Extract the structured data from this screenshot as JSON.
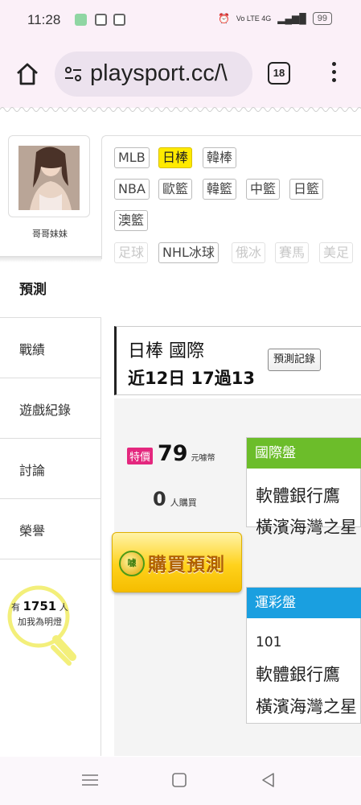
{
  "status_bar": {
    "time": "11:28",
    "battery": "99",
    "network_text": "Vo LTE 4G"
  },
  "browser": {
    "url": "playsport.cc/\\",
    "tab_count": "18"
  },
  "profile": {
    "name": "哥哥妹妹"
  },
  "sidebar": {
    "predict_tab": "預測",
    "items": [
      {
        "label": "戰績"
      },
      {
        "label": "遊戲紀錄"
      },
      {
        "label": "討論"
      },
      {
        "label": "榮譽"
      }
    ],
    "fan": {
      "prefix": "有",
      "count": "1751",
      "suffix": "人",
      "caption": "加我為明燈"
    }
  },
  "leagues": {
    "row1": [
      {
        "label": "MLB",
        "state": "normal"
      },
      {
        "label": "日棒",
        "state": "active"
      },
      {
        "label": "韓棒",
        "state": "normal"
      }
    ],
    "row2": [
      {
        "label": "NBA",
        "state": "normal"
      },
      {
        "label": "歐籃",
        "state": "normal"
      },
      {
        "label": "韓籃",
        "state": "normal"
      },
      {
        "label": "中籃",
        "state": "normal"
      },
      {
        "label": "日籃",
        "state": "normal"
      }
    ],
    "row3": [
      {
        "label": "澳籃",
        "state": "normal"
      }
    ],
    "row4": [
      {
        "label": "足球",
        "state": "disabled"
      },
      {
        "label": "NHL冰球",
        "state": "normal"
      },
      {
        "label": "俄冰",
        "state": "disabled"
      },
      {
        "label": "賽馬",
        "state": "disabled"
      },
      {
        "label": "美足",
        "state": "disabled"
      }
    ]
  },
  "game": {
    "title": "日棒 國際",
    "record": "近12日 17過13",
    "record_button": "預測記錄"
  },
  "purchase": {
    "sale_badge": "特價",
    "price": "79",
    "price_unit": "元噱幣",
    "buyer_count": "0",
    "buyer_unit": "人購買",
    "buy_button": "購買預測",
    "buy_icon_text": "噱"
  },
  "panels": {
    "international": {
      "header": "國際盤",
      "color": "#6cbd2a",
      "lines": [
        "軟體銀行鷹",
        "橫濱海灣之星"
      ]
    },
    "lottery": {
      "header": "運彩盤",
      "color": "#1a9fe0",
      "number": "101",
      "lines": [
        "軟體銀行鷹",
        "橫濱海灣之星"
      ]
    }
  }
}
